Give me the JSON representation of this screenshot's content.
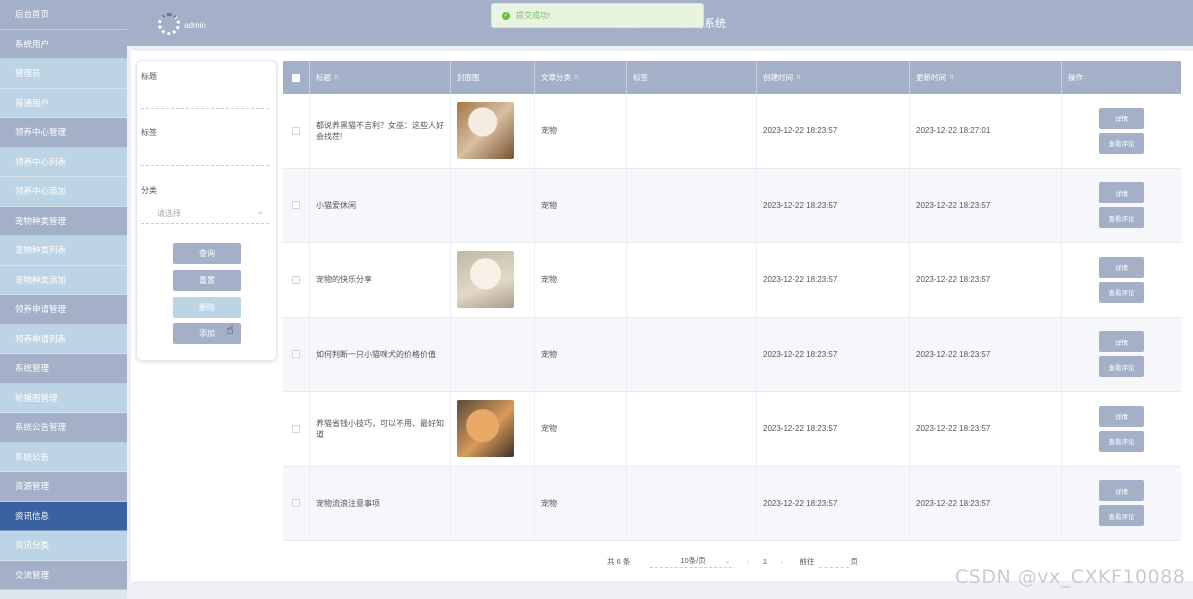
{
  "sidebar": {
    "items": [
      {
        "label": "后台首页",
        "kind": "group"
      },
      {
        "label": "系统用户",
        "kind": "group"
      },
      {
        "label": "管理员",
        "kind": "sub"
      },
      {
        "label": "普通用户",
        "kind": "sub"
      },
      {
        "label": "领养中心管理",
        "kind": "group"
      },
      {
        "label": "领养中心列表",
        "kind": "sub"
      },
      {
        "label": "领养中心添加",
        "kind": "sub"
      },
      {
        "label": "宠物种类管理",
        "kind": "group"
      },
      {
        "label": "宠物种类列表",
        "kind": "sub"
      },
      {
        "label": "宠物种类添加",
        "kind": "sub"
      },
      {
        "label": "领养申请管理",
        "kind": "group"
      },
      {
        "label": "领养申请列表",
        "kind": "sub"
      },
      {
        "label": "系统管理",
        "kind": "group"
      },
      {
        "label": "轮播图管理",
        "kind": "sub"
      },
      {
        "label": "系统公告管理",
        "kind": "group"
      },
      {
        "label": "系统公告",
        "kind": "sub"
      },
      {
        "label": "资源管理",
        "kind": "group"
      },
      {
        "label": "资讯信息",
        "kind": "active"
      },
      {
        "label": "资讯分类",
        "kind": "sub"
      },
      {
        "label": "交流管理",
        "kind": "group"
      }
    ]
  },
  "header": {
    "username": "admin",
    "title": "欢迎使用流浪动物救助系统",
    "toast": "提交成功!"
  },
  "search": {
    "title_label": "标题",
    "tags_label": "标签",
    "category_label": "分类",
    "category_placeholder": "请选择",
    "query_button": "查询",
    "reset_button": "重置",
    "delete_button": "删除",
    "add_button": "添加"
  },
  "table": {
    "headers": [
      "标题",
      "封面图",
      "文章分类",
      "标签",
      "创建时间",
      "更新时间",
      "操作"
    ],
    "rows": [
      {
        "title": "都说养黑猫不吉利？女巫：这些人好会找茬!",
        "image": "cat-a",
        "category": "宠物",
        "tags": "",
        "created": "2023-12-22 18:23:57",
        "updated": "2023-12-22 18:27:01"
      },
      {
        "title": "小猫爱休闲",
        "image": "",
        "category": "宠物",
        "tags": "",
        "created": "2023-12-22 18:23:57",
        "updated": "2023-12-22 18:23:57"
      },
      {
        "title": "宠物的快乐分享",
        "image": "dog",
        "category": "宠物",
        "tags": "",
        "created": "2023-12-22 18:23:57",
        "updated": "2023-12-22 18:23:57"
      },
      {
        "title": "如何判断一只小猫咪犬的价格价值",
        "image": "",
        "category": "宠物",
        "tags": "",
        "created": "2023-12-22 18:23:57",
        "updated": "2023-12-22 18:23:57"
      },
      {
        "title": "养猫省钱小技巧，可以不用、最好知道",
        "image": "cat-b",
        "category": "宠物",
        "tags": "",
        "created": "2023-12-22 18:23:57",
        "updated": "2023-12-22 18:23:57"
      },
      {
        "title": "宠物流浪注意事项",
        "image": "",
        "category": "宠物",
        "tags": "",
        "created": "2023-12-22 18:23:57",
        "updated": "2023-12-22 18:23:57"
      }
    ],
    "detail_button": "详情",
    "comment_button": "查看评论"
  },
  "pagination": {
    "total": "共 6 条",
    "page_size": "10条/页",
    "current_page": "1",
    "goto_label": "前往",
    "page_suffix": "页"
  },
  "watermark": "CSDN @vx_CXKF10088",
  "colors": {
    "accent": "#a3b0c8",
    "active": "#3a62a0",
    "sub_item": "#bcd4e4"
  }
}
